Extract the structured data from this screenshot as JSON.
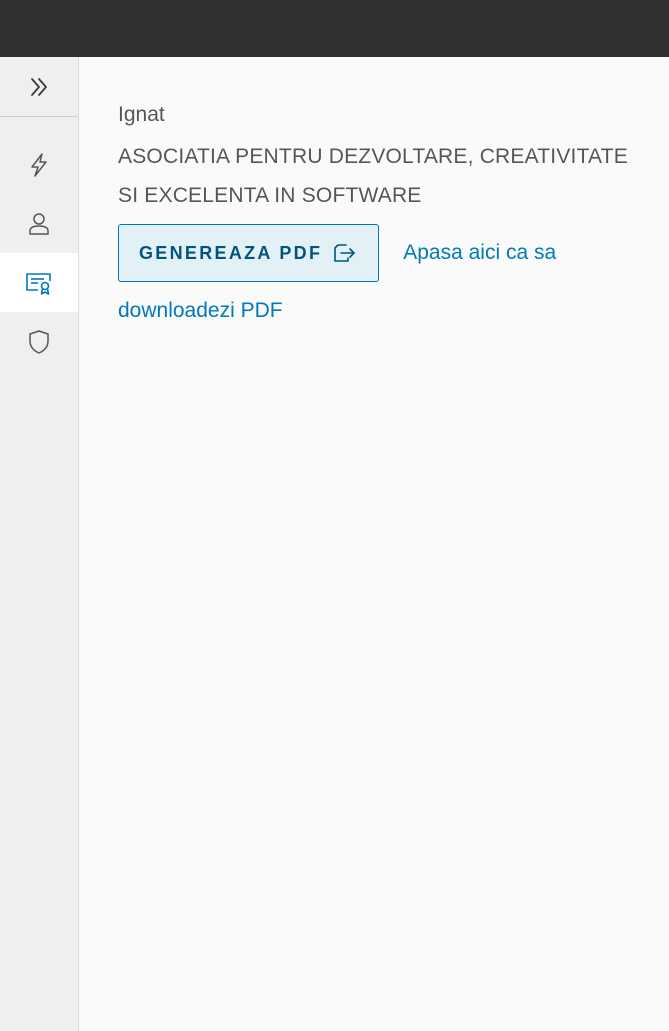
{
  "user": {
    "name": "Ignat",
    "organization": "ASOCIATIA PENTRU DEZVOLTARE, CREATIVITATE SI EXCELENTA IN SOFTWARE"
  },
  "actions": {
    "generate_pdf_label": "GENEREAZA PDF",
    "download_link_text": "Apasa aici ca sa downloadezi PDF"
  },
  "sidenav": {
    "toggle_icon": "double-chevron-right-icon",
    "items": [
      {
        "icon": "lightning-icon",
        "active": false
      },
      {
        "icon": "user-icon",
        "active": false
      },
      {
        "icon": "certificate-icon",
        "active": true
      },
      {
        "icon": "shield-icon",
        "active": false
      }
    ]
  },
  "colors": {
    "topbar": "#313131",
    "sidenav": "#efefef",
    "accent": "#0079b8",
    "button_bg": "#e1f1f6",
    "text": "#565656"
  }
}
